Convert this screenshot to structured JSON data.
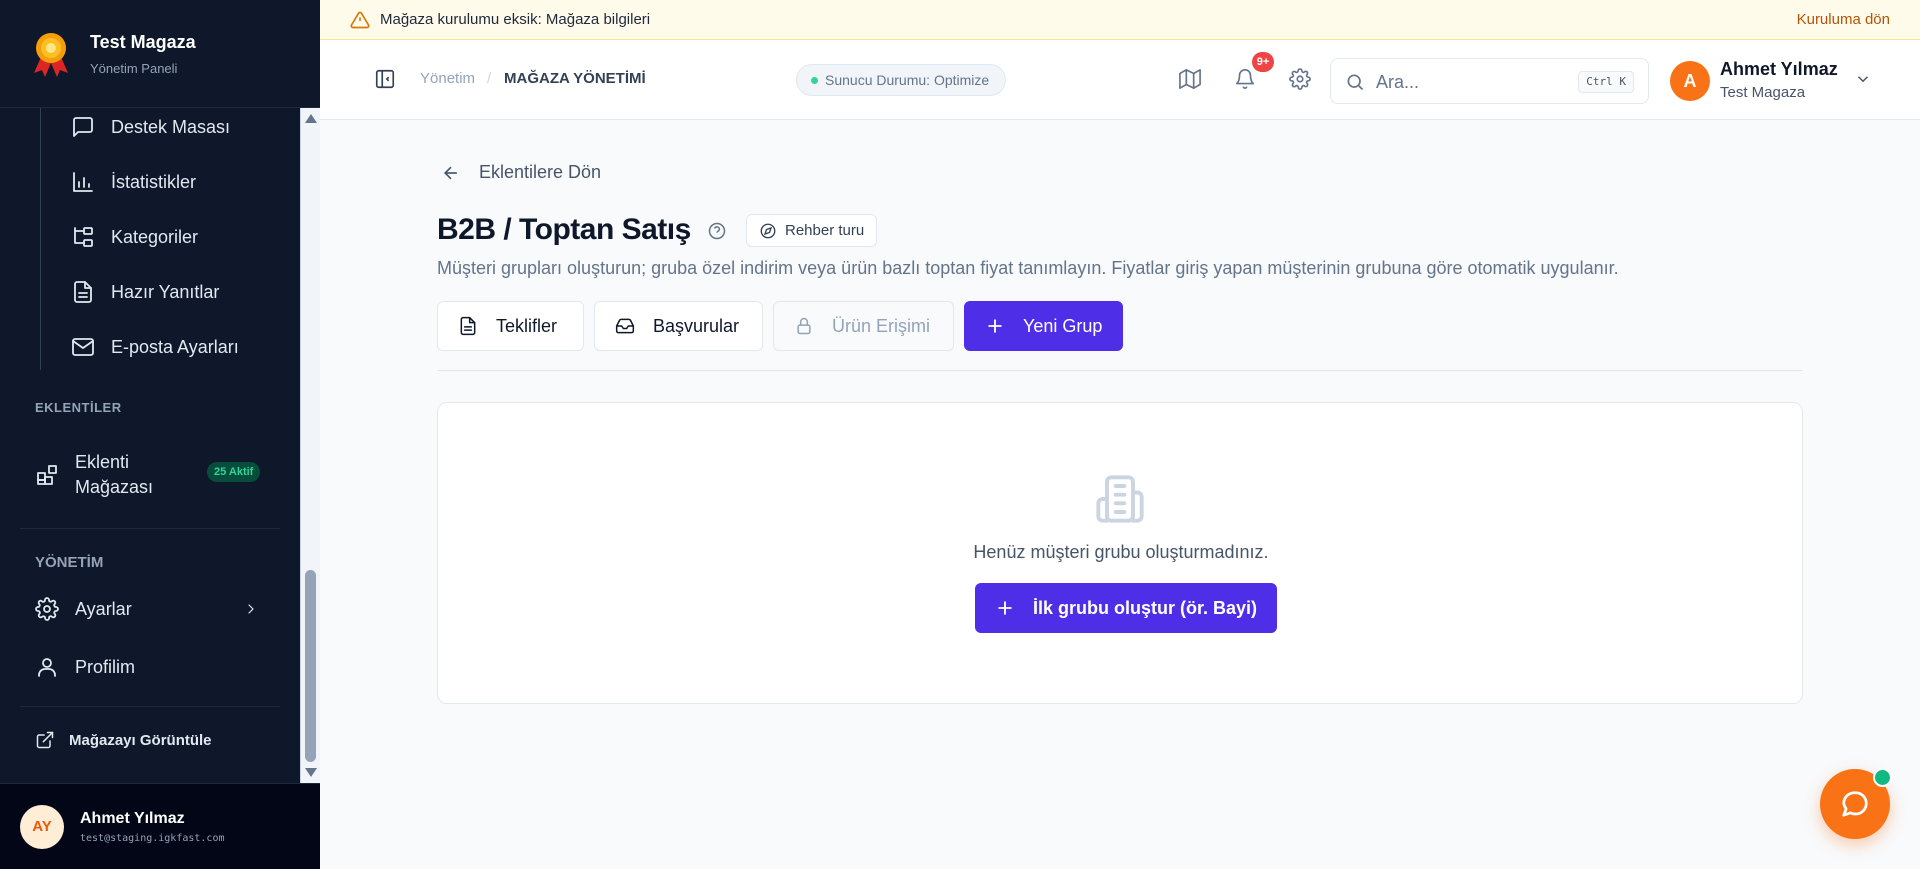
{
  "brand": {
    "title": "Test Magaza",
    "subtitle": "Yönetim Paneli",
    "logo_icon": "award-icon"
  },
  "sidebar": {
    "sub_items": [
      {
        "label": "Destek Masası",
        "icon": "message-square-icon"
      },
      {
        "label": "İstatistikler",
        "icon": "bar-chart-icon"
      },
      {
        "label": "Kategoriler",
        "icon": "folder-tree-icon"
      },
      {
        "label": "Hazır Yanıtlar",
        "icon": "file-text-icon"
      },
      {
        "label": "E-posta Ayarları",
        "icon": "mail-icon"
      }
    ],
    "section_plugins": "EKLENTİLER",
    "plugin_store": {
      "label_line1": "Eklenti",
      "label_line2": "Mağazası",
      "badge": "25 Aktif",
      "icon": "blocks-icon"
    },
    "section_admin": "YÖNETİM",
    "settings": {
      "label": "Ayarlar",
      "icon": "gear-icon"
    },
    "profile": {
      "label": "Profilim",
      "icon": "user-icon"
    },
    "view_store": {
      "label": "Mağazayı Görüntüle",
      "icon": "external-link-icon"
    },
    "footer": {
      "initials": "AY",
      "name": "Ahmet Yılmaz",
      "email": "test@staging.igkfast.com"
    }
  },
  "banner": {
    "text": "Mağaza kurulumu eksik:",
    "link": "Mağaza bilgileri",
    "action": "Kuruluma dön",
    "bg_color": "#fffbeb",
    "icon": "warning-triangle-icon"
  },
  "header": {
    "breadcrumb": [
      "Yönetim",
      "MAĞAZA YÖNETİMİ"
    ],
    "breadcrumb_separator": "/",
    "server_status": "Sunucu Durumu: Optimize",
    "notification_count": "9+",
    "search_placeholder": "Ara...",
    "search_shortcut": "Ctrl K",
    "user": {
      "initial": "A",
      "name": "Ahmet Yılmaz",
      "store": "Test Magaza"
    }
  },
  "main": {
    "back_label": "Eklentilere Dön",
    "title": "B2B / Toptan Satış",
    "tour_label": "Rehber turu",
    "description": "Müşteri grupları oluşturun; gruba özel indirim veya ürün bazlı toptan fiyat tanımlayın. Fiyatlar giriş yapan müşterinin grubuna göre otomatik uygulanır.",
    "buttons": {
      "offers": "Teklifler",
      "applications": "Başvurular",
      "product_access": "Ürün Erişimi",
      "new_group": "Yeni Grup"
    },
    "empty_state": {
      "text": "Henüz müşteri grubu oluşturmadınız.",
      "cta": "İlk grubu oluştur (ör. Bayi)",
      "icon": "building-icon"
    }
  },
  "colors": {
    "sidebar_bg": "#0f172a",
    "primary": "#4f2ee8",
    "accent_orange": "#f97316",
    "badge_red": "#ef4444",
    "success_green": "#10b981"
  }
}
